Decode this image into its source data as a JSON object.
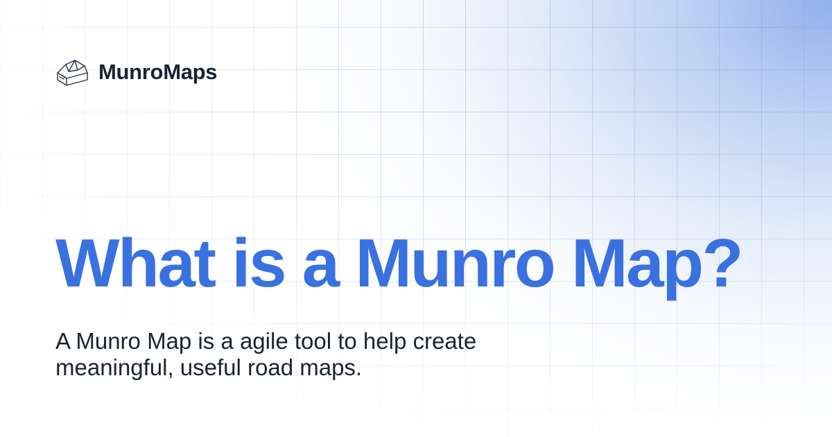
{
  "brand": {
    "name": "MunroMaps",
    "icon": "mountain-house-icon"
  },
  "headline": "What is a Munro Map?",
  "description": "A Munro Map is a agile tool to help create meaningful, useful road maps.",
  "colors": {
    "headline": "#3a71e0",
    "text": "#1b2233",
    "gradient": "#8aacec"
  }
}
